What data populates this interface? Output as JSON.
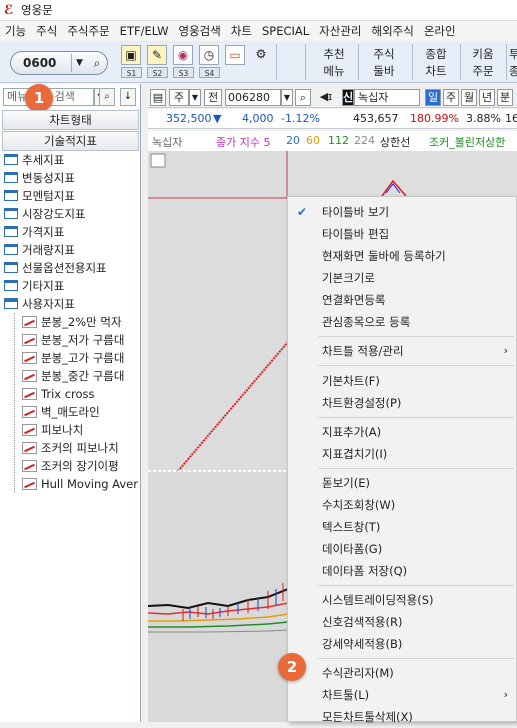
{
  "window": {
    "title": "영웅문"
  },
  "menubar": [
    "기능",
    "주식",
    "주식주문",
    "ETF/ELW",
    "영웅검색",
    "차트",
    "SPECIAL",
    "자산관리",
    "해외주식",
    "온라인"
  ],
  "toolbar": {
    "code": "0600",
    "slot_labels": [
      "S1",
      "S2",
      "S3",
      "S4"
    ],
    "buttons": [
      {
        "line1": "추천",
        "line2": "메뉴"
      },
      {
        "line1": "주식",
        "line2": "둘바"
      },
      {
        "line1": "종합",
        "line2": "차트"
      },
      {
        "line1": "키움",
        "line2": "주문"
      },
      {
        "line1": "투",
        "line2": "종"
      }
    ]
  },
  "left": {
    "search_placeholder": "메뉴/지표 검색",
    "tab1": "차트형태",
    "tab2": "기술적지표",
    "badge1": "1",
    "folders": [
      "추세지표",
      "변동성지표",
      "모멘텀지표",
      "시장강도지표",
      "가격지표",
      "거래량지표",
      "선물옵션전용지표",
      "기타지표",
      "사용자지표"
    ],
    "user_items": [
      "분봉_2%만 먹자",
      "분봉_저가 구름대",
      "분봉_고가 구름대",
      "분봉_중간 구름대",
      "Trix cross",
      "벽_매도라인",
      "피보나치",
      "조커의 피보나치 ",
      "조커의 장기이평 ",
      "Hull Moving Aver"
    ]
  },
  "chart_controls": {
    "period": "주",
    "prev": "전",
    "code": "006280",
    "name": "녹십자",
    "badge_sin": "신",
    "periods": [
      "일",
      "주",
      "월",
      "년",
      "분"
    ],
    "price": "352,500",
    "down_mark": "▼",
    "change": "4,000",
    "change_pct": "-1.12%",
    "volume": "453,657",
    "vol_pct": "180.99%",
    "ratio": "3.88%",
    "extra": "16"
  },
  "legend": {
    "name": "녹십자",
    "ma_label": "종가 지수 5",
    "ma20": "20",
    "ma60": "60",
    "ma112": "112",
    "ma224": "224",
    "upper": "상한선",
    "joker": "조커_볼린저상한"
  },
  "context_menu": {
    "badge2": "2",
    "items": [
      {
        "label": "타이틀바 보기",
        "checked": true
      },
      {
        "label": "타이틀바 편집"
      },
      {
        "label": "현재화면 둘바에 등록하기"
      },
      {
        "label": "기본크기로"
      },
      {
        "label": "연결화면등록"
      },
      {
        "label": "관심종목으로 등록"
      },
      {
        "label": "차트틀 적용/관리",
        "submenu": true
      },
      {
        "label": "기본차트(F)"
      },
      {
        "label": "차트환경설정(P)"
      },
      {
        "label": "지표추가(A)"
      },
      {
        "label": "지표겹치기(I)"
      },
      {
        "label": "돋보기(E)"
      },
      {
        "label": "수치조회창(W)"
      },
      {
        "label": "텍스트창(T)"
      },
      {
        "label": "데이타폼(G)"
      },
      {
        "label": "데이타폼 저장(Q)"
      },
      {
        "label": "시스템트레이딩적용(S)"
      },
      {
        "label": "신호검색적용(R)"
      },
      {
        "label": "강세약세적용(B)"
      },
      {
        "label": "수식관리자(M)"
      },
      {
        "label": "차트툴(L)",
        "submenu": true
      },
      {
        "label": "모든차트툴삭제(X)"
      }
    ]
  }
}
